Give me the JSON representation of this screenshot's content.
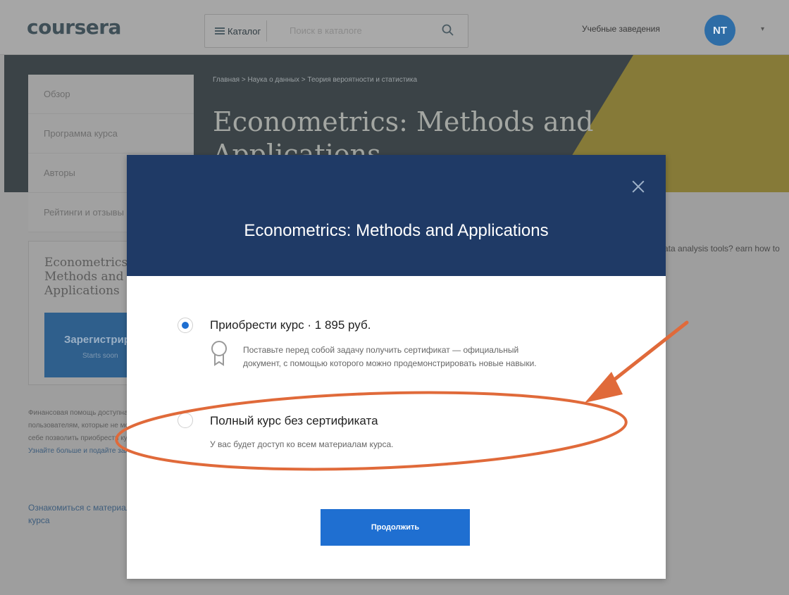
{
  "header": {
    "logo": "coursera",
    "catalog_label": "Каталог",
    "search_placeholder": "Поиск в каталоге",
    "institutions_label": "Учебные заведения",
    "avatar_initials": "NT"
  },
  "banner": {
    "breadcrumb": "Главная  >  Наука о данных  >  Теория вероятности и статистика",
    "course_title": "Econometrics: Methods and Applications"
  },
  "sidebar": {
    "items": [
      {
        "label": "Обзор"
      },
      {
        "label": "Программа курса"
      },
      {
        "label": "Авторы"
      },
      {
        "label": "Рейтинги и отзывы"
      }
    ],
    "card_title": "Econometrics: Methods and Applications",
    "enroll_label": "Зарегистрироваться",
    "enroll_sub": "Starts soon",
    "aid_text": "Финансовая помощь доступна пользователям, которые не могут себе позволить приобрести курс.",
    "aid_link": "Узнайте больше и подайте заявку.",
    "syllabus_link": "Ознакомиться с материалами курса"
  },
  "background_text": "ata analysis tools? earn how to",
  "modal": {
    "title": "Econometrics: Methods and Applications",
    "option1": {
      "title": "Приобрести курс · 1 895 руб.",
      "description": "Поставьте перед собой задачу получить сертификат — официальный документ, с помощью которого можно продемонстрировать новые навыки.",
      "selected": true
    },
    "option2": {
      "title": "Полный курс без сертификата",
      "description": "У вас будет доступ ко всем материалам курса.",
      "selected": false
    },
    "continue_label": "Продолжить"
  },
  "colors": {
    "brand_blue": "#1f6fd1",
    "modal_header": "#1f3a66",
    "annotation": "#e06a3a"
  }
}
